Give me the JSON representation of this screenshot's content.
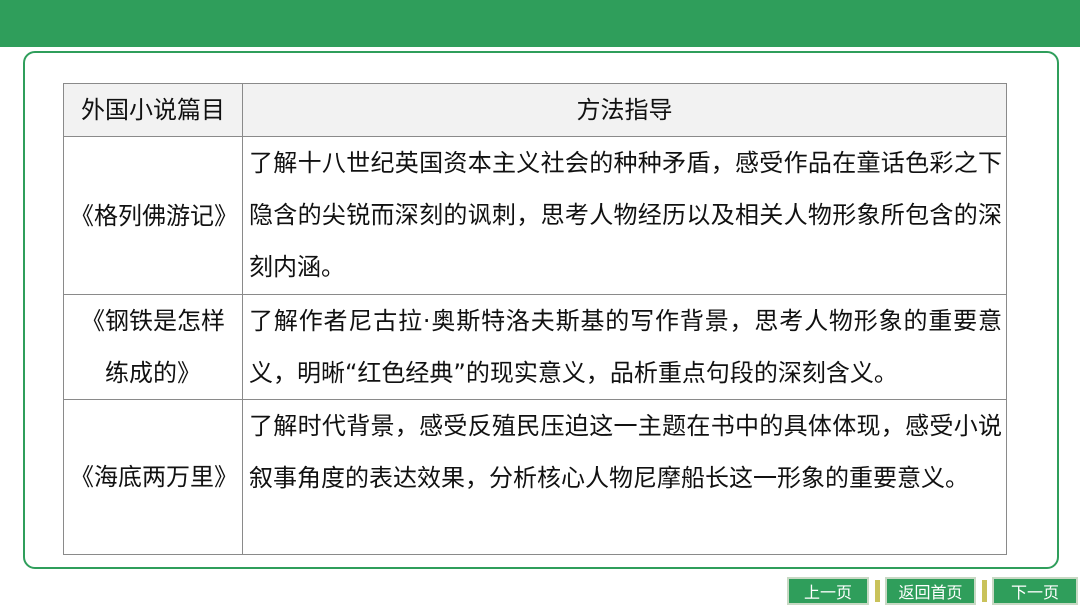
{
  "table": {
    "headers": [
      "外国小说篇目",
      "方法指导"
    ],
    "rows": [
      {
        "title": "《格列佛游记》",
        "method": "了解十八世纪英国资本主义社会的种种矛盾，感受作品在童话色彩之下隐含的尖锐而深刻的讽刺，思考人物经历以及相关人物形象所包含的深刻内涵。"
      },
      {
        "title": "《钢铁是怎样练成的》",
        "method": "了解作者尼古拉·奥斯特洛夫斯基的写作背景，思考人物形象的重要意义，明晰“红色经典”的现实意义，品析重点句段的深刻含义。"
      },
      {
        "title": "《海底两万里》",
        "method": "了解时代背景，感受反殖民压迫这一主题在书中的具体体现，感受小说叙事角度的表达效果，分析核心人物尼摩船长这一形象的重要意义。"
      }
    ]
  },
  "nav": {
    "prev": "上一页",
    "home": "返回首页",
    "next": "下一页"
  },
  "colors": {
    "accent": "#2f9e5b",
    "separator": "#c9c25a"
  }
}
